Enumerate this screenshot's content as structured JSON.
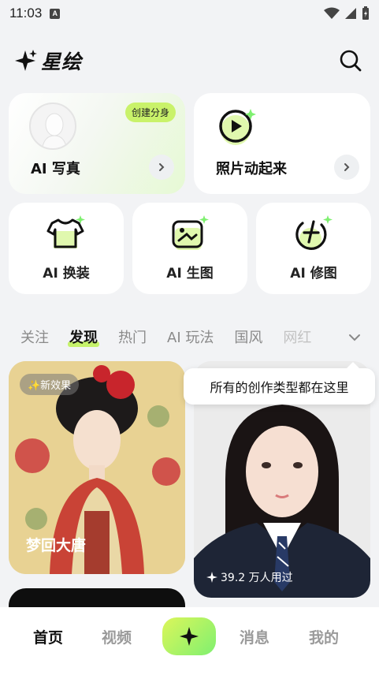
{
  "status_bar": {
    "time": "11:03",
    "notif_letter": "A"
  },
  "header": {
    "app_name": "星绘"
  },
  "features": {
    "portrait": {
      "title": "AI 写真",
      "tag": "创建分身"
    },
    "animate": {
      "title": "照片动起来"
    },
    "outfit": {
      "label": "AI 换装"
    },
    "generate": {
      "label": "AI 生图"
    },
    "retouch": {
      "label": "AI 修图"
    }
  },
  "tabs": [
    {
      "label": "关注"
    },
    {
      "label": "发现",
      "active": true
    },
    {
      "label": "热门"
    },
    {
      "label": "AI 玩法"
    },
    {
      "label": "国风"
    },
    {
      "label": "网红"
    }
  ],
  "tooltip": "所有的创作类型都在这里",
  "feed": [
    {
      "badge": "✨新效果",
      "title": "梦回大唐"
    },
    {
      "usage": "39.2 万人用过"
    }
  ],
  "bottom_nav": {
    "home": "首页",
    "video": "视频",
    "messages": "消息",
    "mine": "我的"
  },
  "colors": {
    "accent": "#c6f26b",
    "accent_green": "#7ff070"
  }
}
